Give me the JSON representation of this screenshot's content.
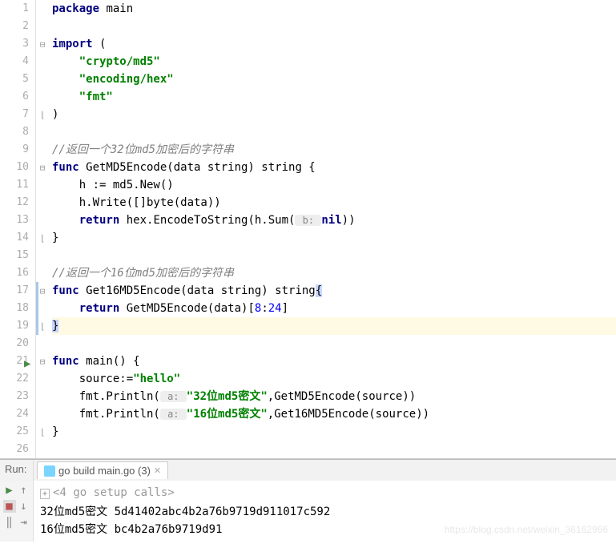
{
  "lines": {
    "l1_package": "package",
    "l1_main": " main",
    "l3_import": "import",
    "l3_paren": " (",
    "l4_str": "\"crypto/md5\"",
    "l5_str": "\"encoding/hex\"",
    "l6_str": "\"fmt\"",
    "l7": ")",
    "l9_comment": "//返回一个32位md5加密后的字符串",
    "l10_func": "func",
    "l10_rest": " GetMD5Encode(data string) string {",
    "l11": "    h := md5.New()",
    "l12": "    h.Write([]byte(data))",
    "l13_return": "    return",
    "l13_rest": " hex.EncodeToString(h.Sum(",
    "l13_hint": " b: ",
    "l13_nil": "nil",
    "l13_end": "))",
    "l14": "}",
    "l16_comment": "//返回一个16位md5加密后的字符串",
    "l17_func": "func",
    "l17_rest": " Get16MD5Encode(data string) string",
    "l17_brace": "{",
    "l18_return": "    return",
    "l18_rest": " GetMD5Encode(data)[",
    "l18_n1": "8",
    "l18_colon": ":",
    "l18_n2": "24",
    "l18_end": "]",
    "l19_brace": "}",
    "l21_func": "func",
    "l21_rest": " main() {",
    "l22_a": "    source:=",
    "l22_str": "\"hello\"",
    "l23_a": "    fmt.Println(",
    "l23_hint": " a: ",
    "l23_str": "\"32位md5密文\"",
    "l23_b": ",GetMD5Encode(source))",
    "l24_a": "    fmt.Println(",
    "l24_hint": " a: ",
    "l24_str": "\"16位md5密文\"",
    "l24_b": ",Get16MD5Encode(source))",
    "l25": "}"
  },
  "run": {
    "label": "Run:",
    "tab": "go build main.go (3)",
    "setup": "<4 go setup calls>",
    "out1": "32位md5密文 5d41402abc4b2a76b9719d911017c592",
    "out2": "16位md5密文 bc4b2a76b9719d91"
  },
  "watermark": "https://blog.csdn.net/weixin_36162966"
}
